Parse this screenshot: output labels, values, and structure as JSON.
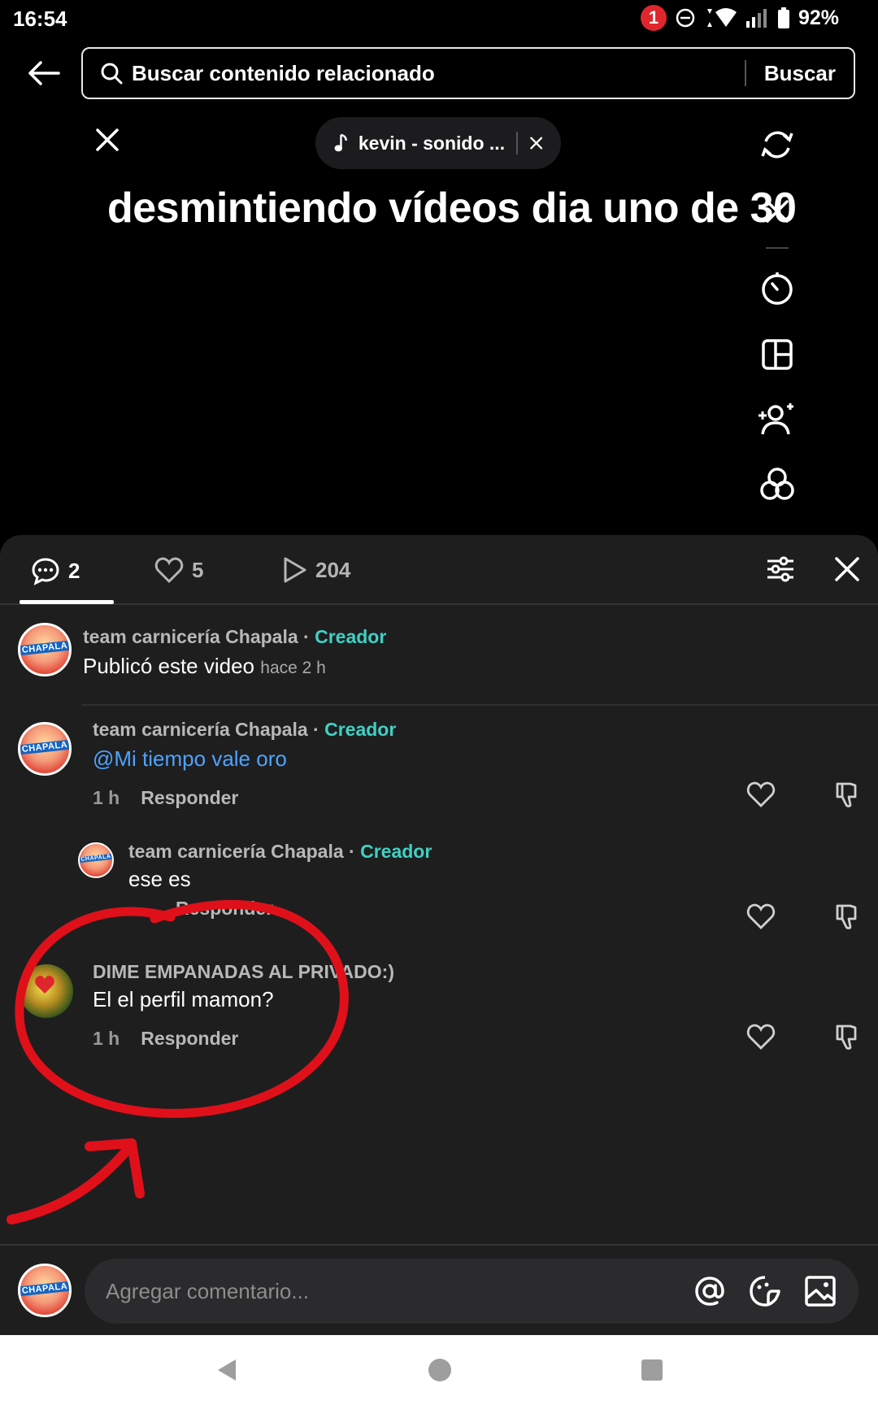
{
  "status_bar": {
    "time": "16:54",
    "notification_count": "1",
    "battery": "92%"
  },
  "search": {
    "placeholder": "Buscar contenido relacionado",
    "button_label": "Buscar"
  },
  "video": {
    "sound_label": "kevin - sonido ...",
    "title": "desmintiendo vídeos dia uno de 30"
  },
  "tabs": [
    {
      "label": "2",
      "icon": "comment-icon",
      "active": true
    },
    {
      "label": "5",
      "icon": "heart-icon",
      "active": false
    },
    {
      "label": "204",
      "icon": "play-icon",
      "active": false
    }
  ],
  "comments": [
    {
      "author": "team carnicería Chapala",
      "badge": "Creador",
      "text": "Publicó este video",
      "time": "hace 2 h",
      "avatar_text": "CHAPALA"
    },
    {
      "author": "team carnicería Chapala",
      "badge": "Creador",
      "text": "@Mi tiempo vale oro",
      "time": "1 h",
      "reply_label": "Responder",
      "avatar_text": "CHAPALA"
    },
    {
      "author": "team carnicería Chapala",
      "badge": "Creador",
      "text": "ese es",
      "reply_label": "Responder",
      "avatar_text": "CHAPALA"
    },
    {
      "author": "DIME EMPANADAS AL PRIVADO:)",
      "text": "El el perfil mamon?",
      "time": "1 h",
      "reply_label": "Responder"
    }
  ],
  "composer": {
    "placeholder": "Agregar comentario...",
    "avatar_text": "CHAPALA"
  },
  "colors": {
    "background": "#000000",
    "panel": "#1e1e1f",
    "creator_badge": "#3fd1c4",
    "mention": "#4ea3ff",
    "annotation_red": "#e0101a"
  }
}
